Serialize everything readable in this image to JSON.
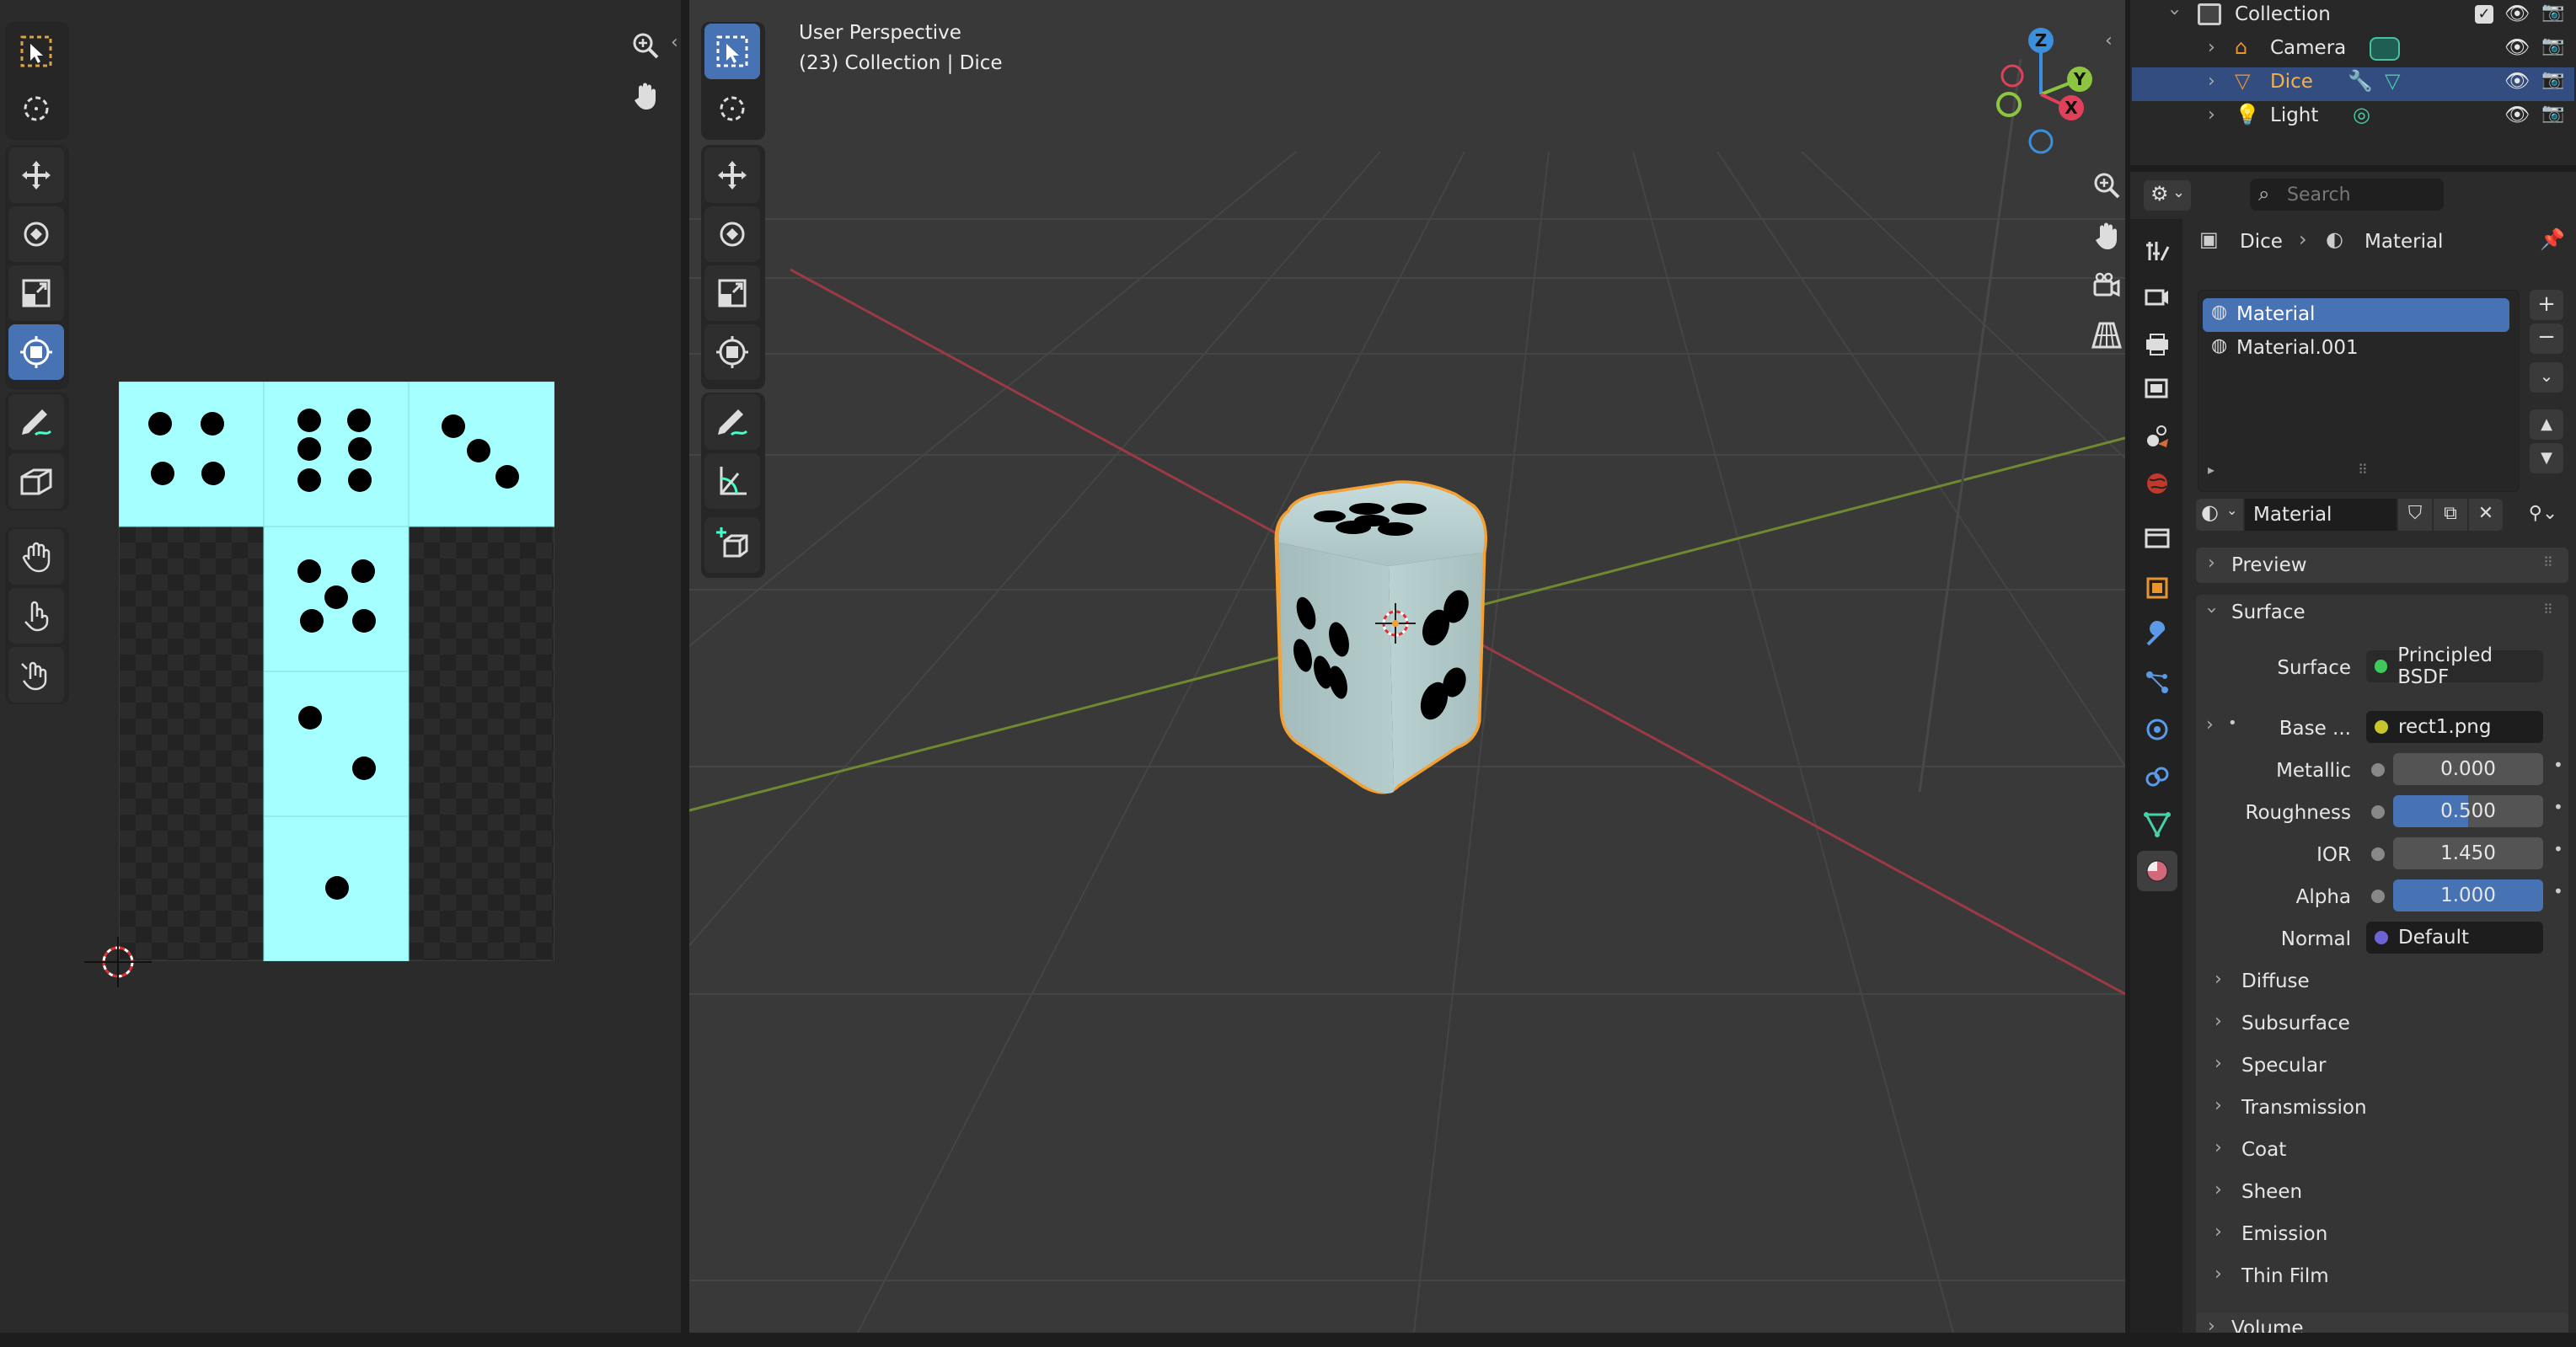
{
  "uv_editor": {
    "faces": [
      {
        "pips": 4
      },
      {
        "pips": 6
      },
      {
        "pips": 3
      },
      {
        "pips": 5
      },
      {
        "pips": 2
      },
      {
        "pips": 1
      }
    ],
    "face_color": "#a6ffff"
  },
  "viewport": {
    "view_name": "User Perspective",
    "context": "(23) Collection | Dice",
    "gizmo": {
      "z": "Z",
      "y": "Y",
      "x": "X"
    }
  },
  "outliner": {
    "rows": [
      {
        "label": "Collection",
        "icon": "collection-icon"
      },
      {
        "label": "Camera",
        "icon": "camera-icon"
      },
      {
        "label": "Dice",
        "icon": "mesh-icon",
        "selected": true
      },
      {
        "label": "Light",
        "icon": "light-icon"
      }
    ]
  },
  "properties": {
    "search_placeholder": "Search",
    "breadcrumb": {
      "object": "Dice",
      "data": "Material"
    },
    "slots": [
      "Material",
      "Material.001"
    ],
    "material_name": "Material",
    "panels": {
      "preview": "Preview",
      "surface": "Surface"
    },
    "surface": {
      "label": "Surface",
      "shader": "Principled BSDF",
      "base_color_label": "Base ...",
      "base_color_value": "rect1.png",
      "metallic_label": "Metallic",
      "metallic": "0.000",
      "roughness_label": "Roughness",
      "roughness": "0.500",
      "ior_label": "IOR",
      "ior": "1.450",
      "alpha_label": "Alpha",
      "alpha": "1.000",
      "normal_label": "Normal",
      "normal": "Default"
    },
    "subpanels": [
      "Diffuse",
      "Subsurface",
      "Specular",
      "Transmission",
      "Coat",
      "Sheen",
      "Emission",
      "Thin Film"
    ],
    "next_panel": "Volume"
  },
  "colors": {
    "accent": "#4772b3",
    "selection_outline": "#f5a033",
    "x_axis": "#e0405a",
    "y_axis": "#8cc63f",
    "z_axis": "#3b8fdc"
  }
}
